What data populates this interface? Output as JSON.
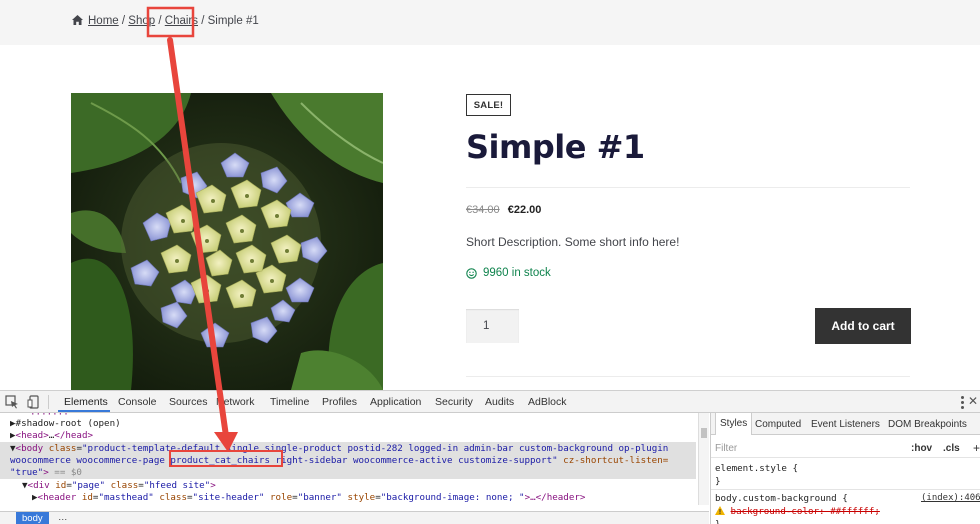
{
  "breadcrumb": {
    "home": "Home",
    "shop": "Shop",
    "category": "Chairs",
    "current": "Simple #1",
    "separator": "/"
  },
  "product": {
    "sale_badge": "SALE!",
    "title": "Simple #1",
    "old_price": "€34.00",
    "new_price": "€22.00",
    "short_description": "Short Description. Some short info here!",
    "stock": "9960 in stock",
    "quantity": "1",
    "add_to_cart": "Add to cart"
  },
  "devtools": {
    "tabs": [
      "Elements",
      "Console",
      "Sources",
      "Network",
      "Timeline",
      "Profiles",
      "Application",
      "Security",
      "Audits",
      "AdBlock"
    ],
    "dom": {
      "shadow": "#shadow-root (open)",
      "head_open": "<head>",
      "head_ellipsis": "…",
      "head_close": "</head>",
      "body_tag": "<body",
      "body_attr": "class",
      "body_val_1": "\"product-template-default single single-product postid-282 logged-in admin-bar custom-background op-plugin",
      "body_val_2a": "woocommerce woocommerce-page ",
      "body_val_highlight": "product_cat_chairs",
      "body_val_2b": " right-sidebar woocommerce-active customize-support\"",
      "body_attr2": " cz-shortcut-listen=",
      "body_val_3": "\"true\"",
      "body_end": ">",
      "eq": " == $0",
      "div_line_tag": "<div",
      "div_attrs": [
        {
          "name": "id",
          "value": "\"page\""
        },
        {
          "name": "class",
          "value": "\"hfeed site\""
        }
      ],
      "header_tag": "<header",
      "header_attrs": [
        {
          "name": "id",
          "value": "\"masthead\""
        },
        {
          "name": "class",
          "value": "\"site-header\""
        },
        {
          "name": "role",
          "value": "\"banner\""
        },
        {
          "name": "style",
          "value": "\"background-image: none; \""
        }
      ],
      "header_end": ">…</header>"
    },
    "bottom_crumb": "body",
    "bottom_more": "…",
    "styles": {
      "tabs": [
        "Styles",
        "Computed",
        "Event Listeners",
        "DOM Breakpoints"
      ],
      "filter_placeholder": "Filter",
      "hov": ":hov",
      "cls": ".cls",
      "plus": "+",
      "rule1_selector": "element.style {",
      "rule1_close": "}",
      "rule2_selector": "body.custom-background {",
      "rule2_source": "(index):406",
      "rule2_prop": "background-color: ##ffffff;",
      "rule2_close": "}"
    }
  },
  "colors": {
    "in_stock": "#0f834d",
    "annotation": "#e8453c",
    "devtools_accent": "#3879d9"
  }
}
